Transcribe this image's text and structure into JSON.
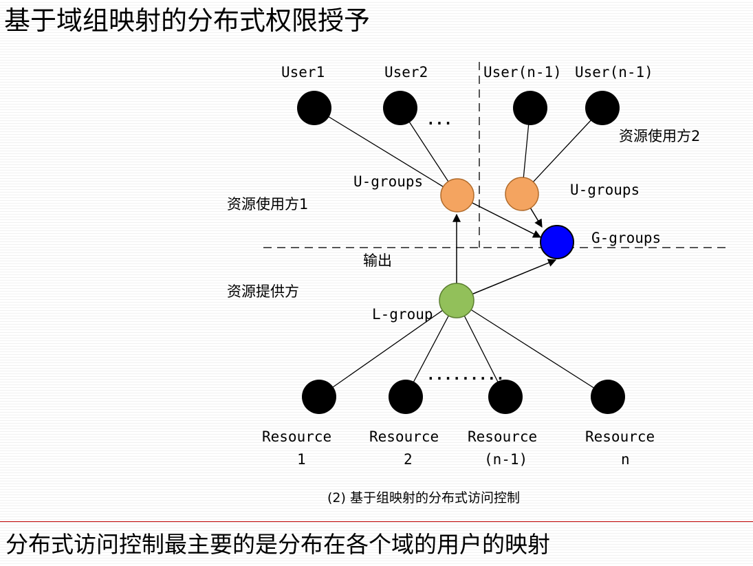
{
  "slide_title": "基于域组映射的分布式权限授予",
  "diagram": {
    "users": [
      "User1",
      "User2",
      "User(n-1)",
      "User(n-1)"
    ],
    "ellipsis": "...",
    "resource_user_1": "资源使用方1",
    "resource_user_2": "资源使用方2",
    "u_groups_left": "U-groups",
    "u_groups_right": "U-groups",
    "g_groups": "G-groups",
    "output": "输出",
    "resource_provider": "资源提供方",
    "l_group": "L-group",
    "resources_ellipsis": ".........",
    "resources": [
      {
        "name": "Resource",
        "index": "1"
      },
      {
        "name": "Resource",
        "index": "2"
      },
      {
        "name": "Resource",
        "index": "(n-1)"
      },
      {
        "name": "Resource",
        "index": "n"
      }
    ],
    "caption": "(2) 基于组映射的分布式访问控制",
    "colors": {
      "u_group": "#f4a460",
      "g_group": "#0000ff",
      "l_group": "#92c05a",
      "node": "#000000"
    }
  },
  "bottom_statement": "分布式访问控制最主要的是分布在各个域的用户的映射"
}
